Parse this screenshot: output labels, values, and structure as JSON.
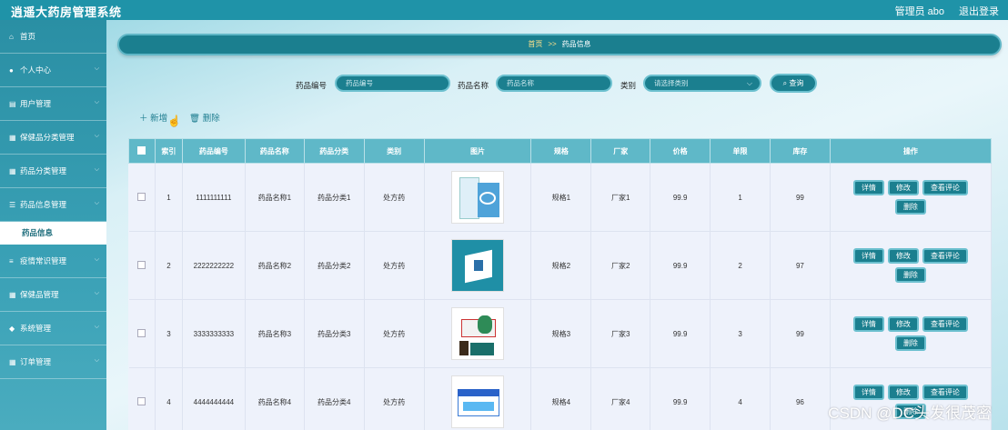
{
  "header": {
    "title": "逍遥大药房管理系统",
    "admin": "管理员 abo",
    "logout": "退出登录"
  },
  "sidebar": {
    "items": [
      {
        "label": "首页",
        "icon": "home-icon"
      },
      {
        "label": "个人中心",
        "icon": "user-icon"
      },
      {
        "label": "用户管理",
        "icon": "doc-icon"
      },
      {
        "label": "保健品分类管理",
        "icon": "grid-icon"
      },
      {
        "label": "药品分类管理",
        "icon": "grid-icon"
      },
      {
        "label": "药品信息管理",
        "icon": "sliders-icon"
      },
      {
        "label": "药品信息",
        "sub": true
      },
      {
        "label": "疫情常识管理",
        "icon": "list-icon"
      },
      {
        "label": "保健品管理",
        "icon": "grid-icon"
      },
      {
        "label": "系统管理",
        "icon": "pin-icon"
      },
      {
        "label": "订单管理",
        "icon": "grid-icon"
      }
    ]
  },
  "breadcrumb": {
    "home": "首页",
    "sep": ">>",
    "current": "药品信息"
  },
  "filters": {
    "code_label": "药品编号",
    "code_placeholder": "药品编号",
    "name_label": "药品名称",
    "name_placeholder": "药品名称",
    "type_label": "类别",
    "type_placeholder": "请选择类别",
    "search": "查询"
  },
  "toolbar": {
    "add": "新增",
    "delete": "删除"
  },
  "table": {
    "headers": [
      "索引",
      "药品编号",
      "药品名称",
      "药品分类",
      "类别",
      "图片",
      "规格",
      "厂家",
      "价格",
      "单限",
      "库存",
      "操作"
    ],
    "rows": [
      {
        "index": "1",
        "code": "1111111111",
        "name": "药品名称1",
        "category": "药品分类1",
        "type": "处方药",
        "spec": "规格1",
        "maker": "厂家1",
        "price": "99.9",
        "limit": "1",
        "stock": "99"
      },
      {
        "index": "2",
        "code": "2222222222",
        "name": "药品名称2",
        "category": "药品分类2",
        "type": "处方药",
        "spec": "规格2",
        "maker": "厂家2",
        "price": "99.9",
        "limit": "2",
        "stock": "97"
      },
      {
        "index": "3",
        "code": "3333333333",
        "name": "药品名称3",
        "category": "药品分类3",
        "type": "处方药",
        "spec": "规格3",
        "maker": "厂家3",
        "price": "99.9",
        "limit": "3",
        "stock": "99"
      },
      {
        "index": "4",
        "code": "4444444444",
        "name": "药品名称4",
        "category": "药品分类4",
        "type": "处方药",
        "spec": "规格4",
        "maker": "厂家4",
        "price": "99.9",
        "limit": "4",
        "stock": "96"
      }
    ],
    "actions": {
      "detail": "详情",
      "edit": "修改",
      "comments": "查看评论",
      "remove": "删除"
    }
  },
  "watermark": "CSDN @DC头发很茂密"
}
